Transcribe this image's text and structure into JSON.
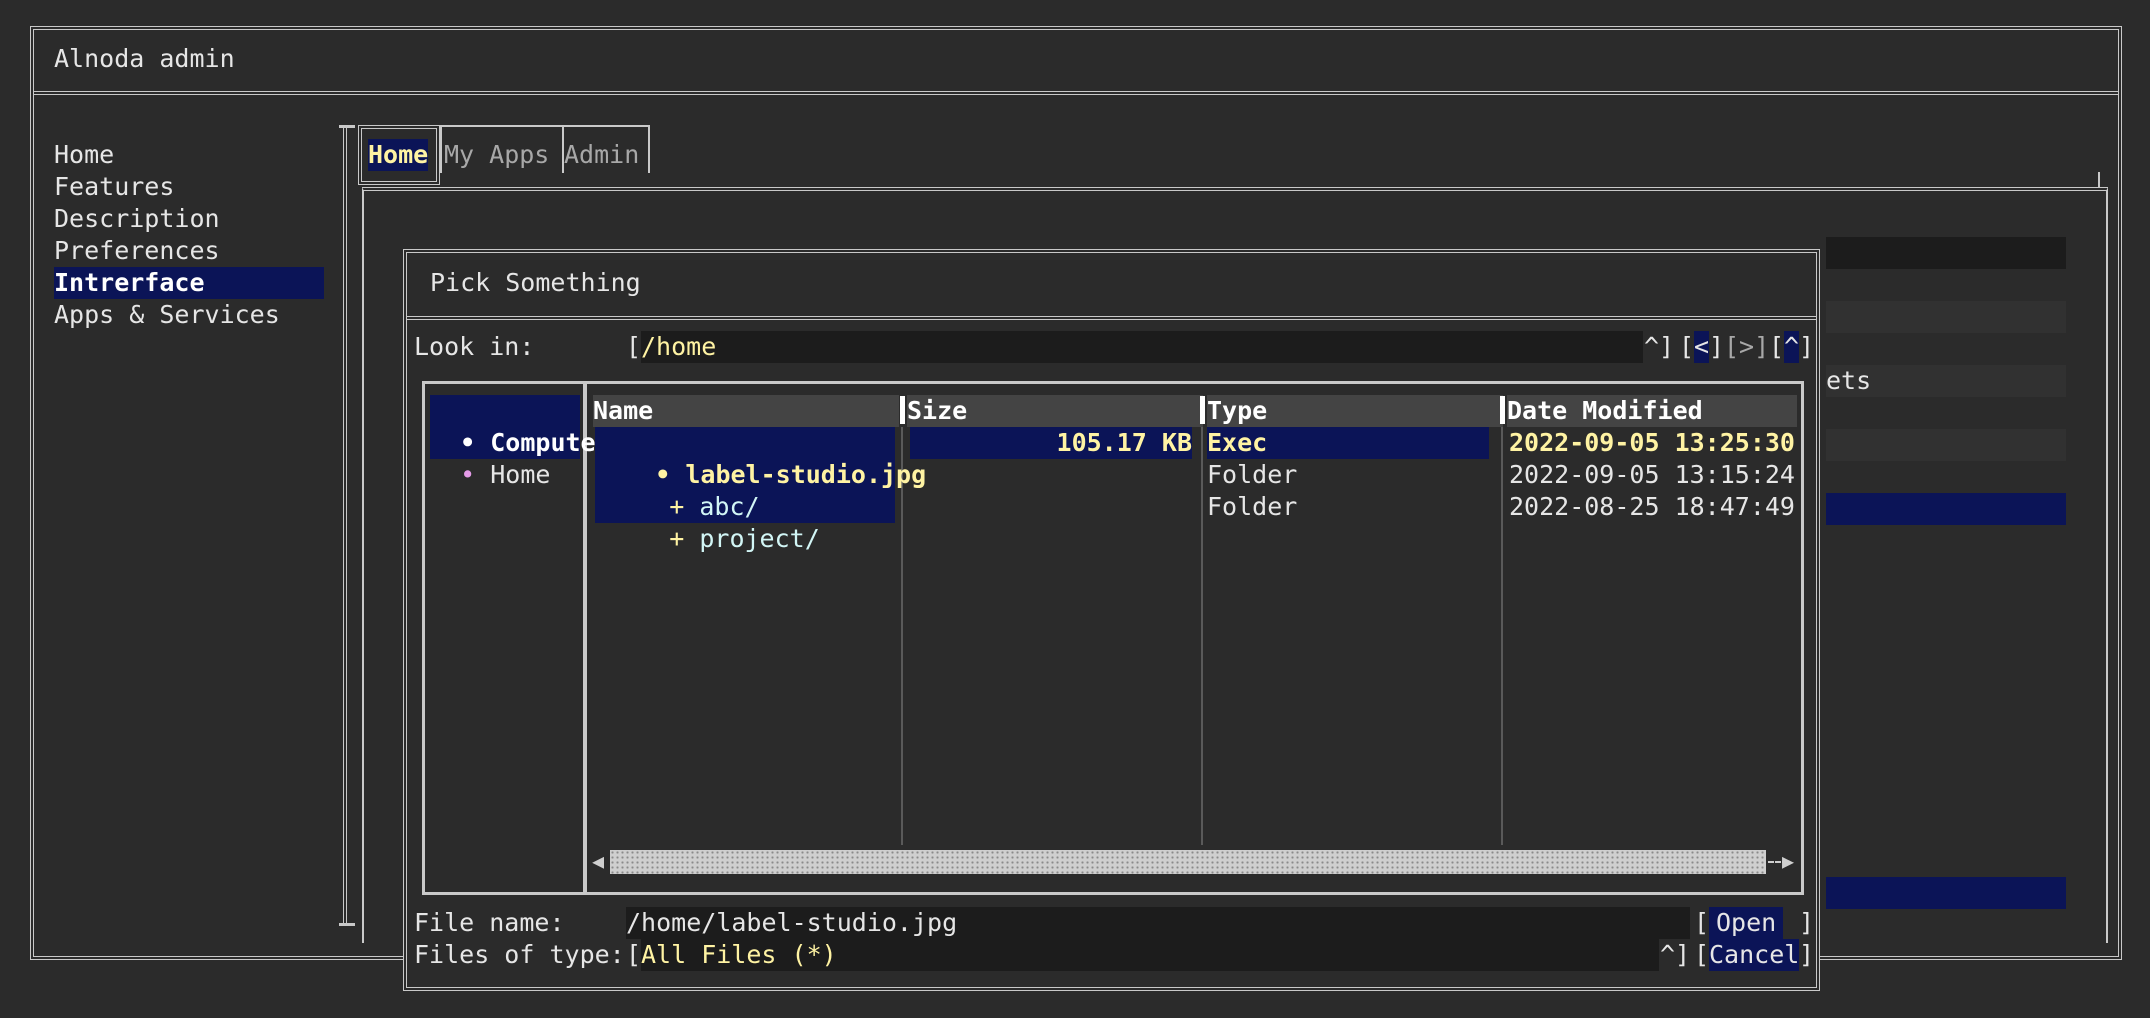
{
  "app": {
    "title": "Alnoda admin"
  },
  "sidebar": {
    "items": [
      {
        "label": "Home"
      },
      {
        "label": "Features"
      },
      {
        "label": "Description"
      },
      {
        "label": "Preferences"
      },
      {
        "label": "Intrerface"
      },
      {
        "label": "Apps & Services"
      }
    ]
  },
  "tabs": [
    {
      "label": "Home"
    },
    {
      "label": "My Apps"
    },
    {
      "label": "Admin"
    }
  ],
  "background": {
    "partial_text": "ets"
  },
  "dialog": {
    "title": "Pick Something",
    "look_in": {
      "label": "Look in:",
      "value": "/home",
      "open_bracket": "[",
      "dropdown": "^]",
      "back_open": "[",
      "back": "<",
      "back_close": "]",
      "forward": "[>]",
      "up_open": "[",
      "up": "^",
      "up_close": "]"
    },
    "places": [
      {
        "bullet": "•",
        "label": "Computer"
      },
      {
        "bullet": "•",
        "label": "Home"
      }
    ],
    "columns": [
      "Name",
      "Size",
      "Type",
      "Date Modified"
    ],
    "files": [
      {
        "prefix": "•",
        "name": "label-studio.jpg",
        "size": "105.17 KB",
        "type": "Exec",
        "modified": "2022-09-05 13:25:30"
      },
      {
        "prefix": "+",
        "name": "abc/",
        "size": "",
        "type": "Folder",
        "modified": "2022-09-05 13:15:24"
      },
      {
        "prefix": "+",
        "name": "project/",
        "size": "",
        "type": "Folder",
        "modified": "2022-08-25 18:47:49"
      }
    ],
    "scrollbar": {
      "left_arrow": "◀",
      "right_arrow": "▶"
    },
    "file_name": {
      "label": "File name:",
      "value": "/home/label-studio.jpg",
      "open_left": "[",
      "open_button": "Open",
      "open_right": "]"
    },
    "files_of_type": {
      "label": "Files of type:",
      "open_bracket": "[",
      "value": "All Files (*)",
      "dropdown": "^]",
      "cancel_left": "[",
      "cancel_button": "Cancel",
      "cancel_right": "]"
    }
  }
}
